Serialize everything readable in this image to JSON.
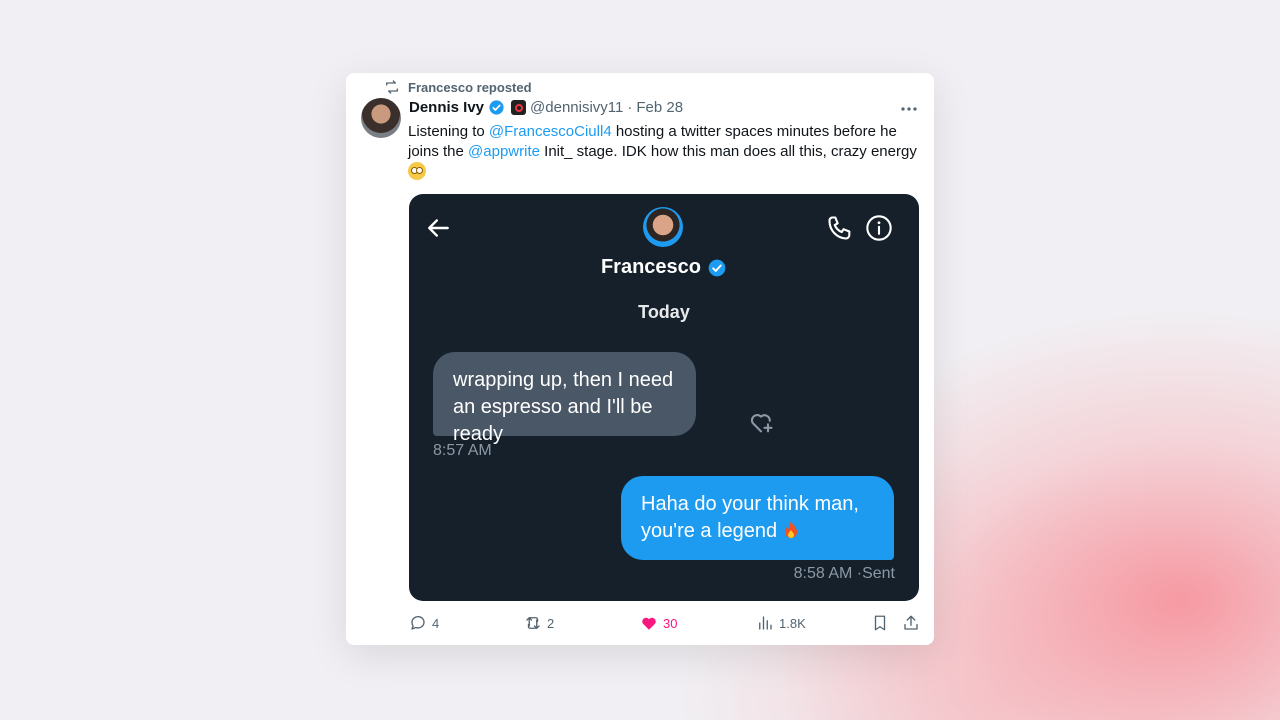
{
  "repost": {
    "label": "Francesco reposted"
  },
  "tweet": {
    "author_name": "Dennis Ivy",
    "handle": "@dennisivy11",
    "separator": "·",
    "date": "Feb 28",
    "text_parts": {
      "p1": "Listening to ",
      "mention1": "@FrancescoCiull4",
      "p2": " hosting a twitter spaces minutes before he joins the ",
      "mention2": "@appwrite",
      "p3": " Init_ stage. IDK how this man does all this, crazy energy "
    }
  },
  "dm": {
    "contact_name": "Francesco",
    "day_label": "Today",
    "incoming_message": "wrapping up, then I need an espresso and I'll be ready",
    "incoming_time": "8:57 AM",
    "outgoing_message": "Haha do your think man, you're a legend ",
    "outgoing_status": "8:58 AM ·Sent"
  },
  "stats": {
    "replies": "4",
    "reposts": "2",
    "likes": "30",
    "views": "1.8K"
  },
  "colors": {
    "accent": "#1d9bf0",
    "like": "#f91880",
    "dm_background": "#15202b",
    "incoming_bubble": "#4a5766"
  }
}
